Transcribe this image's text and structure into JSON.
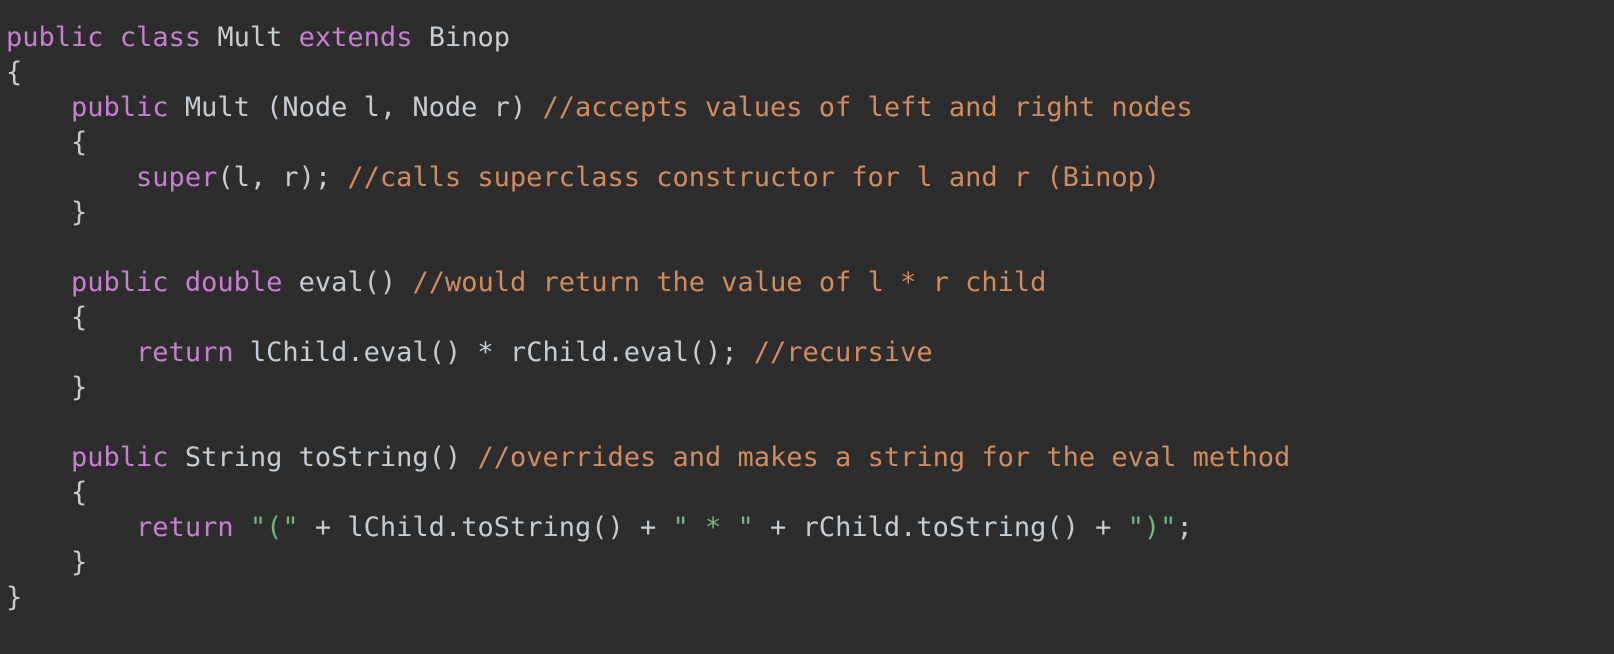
{
  "editor": {
    "background_color": "#2d2d2d",
    "language": "Java",
    "theme_colors": {
      "keyword": "#c87fd2",
      "identifier": "#c5cdd4",
      "comment": "#d08c60",
      "string": "#72b583",
      "punctuation": "#c5cdd4",
      "background": "#2d2d2d"
    },
    "lines": [
      {
        "number": 1,
        "text": "public class Mult extends Binop",
        "tokens": [
          {
            "t": "public",
            "c": "kw"
          },
          {
            "t": " ",
            "c": "plain"
          },
          {
            "t": "class",
            "c": "kw"
          },
          {
            "t": " ",
            "c": "plain"
          },
          {
            "t": "Mult",
            "c": "id"
          },
          {
            "t": " ",
            "c": "plain"
          },
          {
            "t": "extends",
            "c": "kw"
          },
          {
            "t": " ",
            "c": "plain"
          },
          {
            "t": "Binop",
            "c": "id"
          }
        ]
      },
      {
        "number": 2,
        "text": "{",
        "tokens": [
          {
            "t": "{",
            "c": "punc"
          }
        ]
      },
      {
        "number": 3,
        "text": "    public Mult (Node l, Node r) //accepts values of left and right nodes",
        "tokens": [
          {
            "t": "    ",
            "c": "plain"
          },
          {
            "t": "public",
            "c": "kw"
          },
          {
            "t": " Mult (Node l, Node r) ",
            "c": "id"
          },
          {
            "t": "//accepts values of left and right nodes",
            "c": "cmt"
          }
        ]
      },
      {
        "number": 4,
        "text": "    {",
        "tokens": [
          {
            "t": "    {",
            "c": "punc"
          }
        ]
      },
      {
        "number": 5,
        "text": "        super(l, r); //calls superclass constructor for l and r (Binop)",
        "tokens": [
          {
            "t": "        ",
            "c": "plain"
          },
          {
            "t": "super",
            "c": "kw"
          },
          {
            "t": "(l, r); ",
            "c": "id"
          },
          {
            "t": "//calls superclass constructor for l and r (Binop)",
            "c": "cmt"
          }
        ]
      },
      {
        "number": 6,
        "text": "    }",
        "tokens": [
          {
            "t": "    }",
            "c": "punc"
          }
        ]
      },
      {
        "number": 7,
        "text": "",
        "tokens": []
      },
      {
        "number": 8,
        "text": "    public double eval() //would return the value of l * r child",
        "tokens": [
          {
            "t": "    ",
            "c": "plain"
          },
          {
            "t": "public",
            "c": "kw"
          },
          {
            "t": " ",
            "c": "plain"
          },
          {
            "t": "double",
            "c": "kw"
          },
          {
            "t": " eval() ",
            "c": "id"
          },
          {
            "t": "//would return the value of l * r child",
            "c": "cmt"
          }
        ]
      },
      {
        "number": 9,
        "text": "    {",
        "tokens": [
          {
            "t": "    {",
            "c": "punc"
          }
        ]
      },
      {
        "number": 10,
        "text": "        return lChild.eval() * rChild.eval(); //recursive",
        "tokens": [
          {
            "t": "        ",
            "c": "plain"
          },
          {
            "t": "return",
            "c": "kw"
          },
          {
            "t": " lChild.eval() * rChild.eval(); ",
            "c": "id"
          },
          {
            "t": "//recursive",
            "c": "cmt"
          }
        ]
      },
      {
        "number": 11,
        "text": "    }",
        "tokens": [
          {
            "t": "    }",
            "c": "punc"
          }
        ]
      },
      {
        "number": 12,
        "text": "",
        "tokens": []
      },
      {
        "number": 13,
        "text": "    public String toString() //overrides and makes a string for the eval method",
        "tokens": [
          {
            "t": "    ",
            "c": "plain"
          },
          {
            "t": "public",
            "c": "kw"
          },
          {
            "t": " String toString() ",
            "c": "id"
          },
          {
            "t": "//overrides and makes a string for the eval method",
            "c": "cmt"
          }
        ]
      },
      {
        "number": 14,
        "text": "    {",
        "tokens": [
          {
            "t": "    {",
            "c": "punc"
          }
        ]
      },
      {
        "number": 15,
        "text": "        return \"(\" + lChild.toString() + \" * \" + rChild.toString() + \")\";",
        "tokens": [
          {
            "t": "        ",
            "c": "plain"
          },
          {
            "t": "return",
            "c": "kw"
          },
          {
            "t": " ",
            "c": "plain"
          },
          {
            "t": "\"(\"",
            "c": "str"
          },
          {
            "t": " + lChild.toString() + ",
            "c": "id"
          },
          {
            "t": "\" * \"",
            "c": "str"
          },
          {
            "t": " + rChild.toString() + ",
            "c": "id"
          },
          {
            "t": "\")\"",
            "c": "str"
          },
          {
            "t": ";",
            "c": "punc"
          }
        ]
      },
      {
        "number": 16,
        "text": "    }",
        "tokens": [
          {
            "t": "    }",
            "c": "punc"
          }
        ]
      },
      {
        "number": 17,
        "text": "}",
        "tokens": [
          {
            "t": "}",
            "c": "punc"
          }
        ]
      }
    ]
  }
}
